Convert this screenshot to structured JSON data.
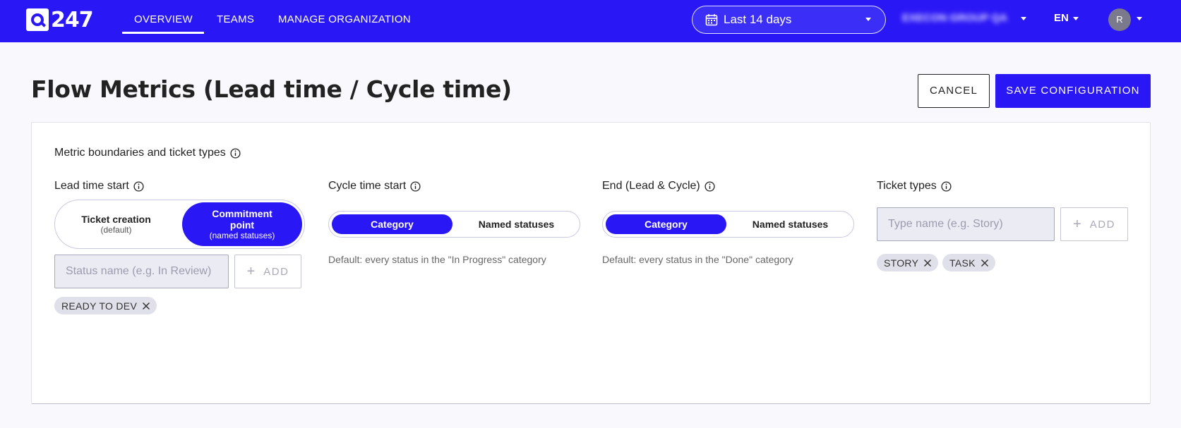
{
  "brand": {
    "logo_text": "247"
  },
  "nav": {
    "items": [
      "OVERVIEW",
      "TEAMS",
      "MANAGE ORGANIZATION"
    ]
  },
  "header": {
    "date_range": "Last 14 days",
    "org_name": "EXECON GROUP QA",
    "language": "EN",
    "avatar_initial": "R"
  },
  "page": {
    "title": "Flow Metrics (Lead time / Cycle time)",
    "cancel_label": "CANCEL",
    "save_label": "SAVE CONFIGURATION"
  },
  "section": {
    "title": "Metric boundaries and ticket types"
  },
  "lead": {
    "label": "Lead time start",
    "option1_main": "Ticket creation",
    "option1_sub": "(default)",
    "option2_main": "Commitment point",
    "option2_sub": "(named statuses)",
    "selected": "option2",
    "input_placeholder": "Status name (e.g. In Review)",
    "add_label": "ADD",
    "chips": [
      "READY TO DEV"
    ]
  },
  "cycle": {
    "label": "Cycle time start",
    "option1": "Category",
    "option2": "Named statuses",
    "selected": "option1",
    "hint": "Default: every status in the \"In Progress\" category"
  },
  "end": {
    "label": "End (Lead & Cycle)",
    "option1": "Category",
    "option2": "Named statuses",
    "selected": "option1",
    "hint": "Default: every status in the \"Done\" category"
  },
  "ticket_types": {
    "label": "Ticket types",
    "input_placeholder": "Type name (e.g. Story)",
    "add_label": "ADD",
    "chips": [
      "STORY",
      "TASK"
    ]
  },
  "colors": {
    "accent": "#2a17f5",
    "chip_bg": "#e0e0ea",
    "input_bg": "#ebebf4"
  }
}
